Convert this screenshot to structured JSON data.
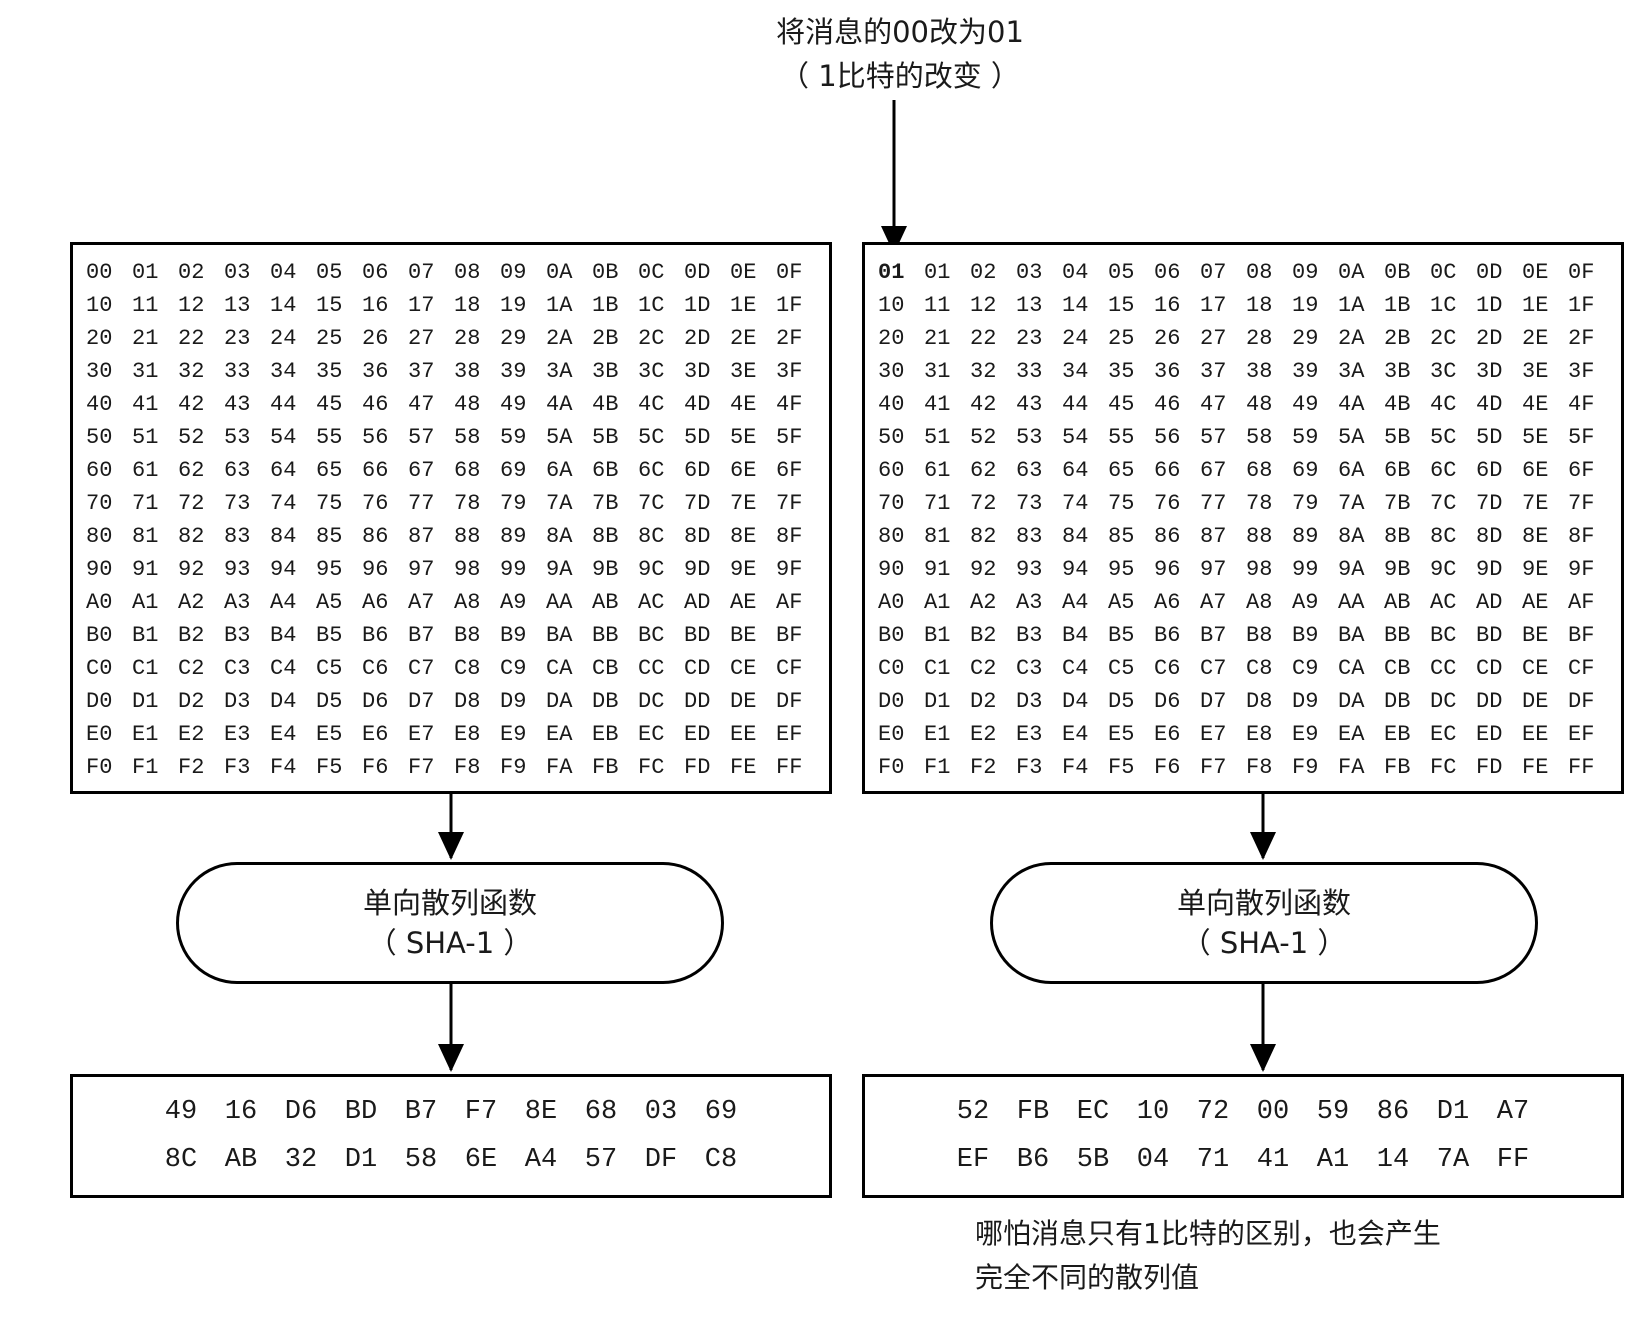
{
  "top_note": {
    "line1": "将消息的00改为01",
    "line2": "（ 1比特的改变 ）"
  },
  "left": {
    "message": [
      [
        "00",
        "01",
        "02",
        "03",
        "04",
        "05",
        "06",
        "07",
        "08",
        "09",
        "0A",
        "0B",
        "0C",
        "0D",
        "0E",
        "0F"
      ],
      [
        "10",
        "11",
        "12",
        "13",
        "14",
        "15",
        "16",
        "17",
        "18",
        "19",
        "1A",
        "1B",
        "1C",
        "1D",
        "1E",
        "1F"
      ],
      [
        "20",
        "21",
        "22",
        "23",
        "24",
        "25",
        "26",
        "27",
        "28",
        "29",
        "2A",
        "2B",
        "2C",
        "2D",
        "2E",
        "2F"
      ],
      [
        "30",
        "31",
        "32",
        "33",
        "34",
        "35",
        "36",
        "37",
        "38",
        "39",
        "3A",
        "3B",
        "3C",
        "3D",
        "3E",
        "3F"
      ],
      [
        "40",
        "41",
        "42",
        "43",
        "44",
        "45",
        "46",
        "47",
        "48",
        "49",
        "4A",
        "4B",
        "4C",
        "4D",
        "4E",
        "4F"
      ],
      [
        "50",
        "51",
        "52",
        "53",
        "54",
        "55",
        "56",
        "57",
        "58",
        "59",
        "5A",
        "5B",
        "5C",
        "5D",
        "5E",
        "5F"
      ],
      [
        "60",
        "61",
        "62",
        "63",
        "64",
        "65",
        "66",
        "67",
        "68",
        "69",
        "6A",
        "6B",
        "6C",
        "6D",
        "6E",
        "6F"
      ],
      [
        "70",
        "71",
        "72",
        "73",
        "74",
        "75",
        "76",
        "77",
        "78",
        "79",
        "7A",
        "7B",
        "7C",
        "7D",
        "7E",
        "7F"
      ],
      [
        "80",
        "81",
        "82",
        "83",
        "84",
        "85",
        "86",
        "87",
        "88",
        "89",
        "8A",
        "8B",
        "8C",
        "8D",
        "8E",
        "8F"
      ],
      [
        "90",
        "91",
        "92",
        "93",
        "94",
        "95",
        "96",
        "97",
        "98",
        "99",
        "9A",
        "9B",
        "9C",
        "9D",
        "9E",
        "9F"
      ],
      [
        "A0",
        "A1",
        "A2",
        "A3",
        "A4",
        "A5",
        "A6",
        "A7",
        "A8",
        "A9",
        "AA",
        "AB",
        "AC",
        "AD",
        "AE",
        "AF"
      ],
      [
        "B0",
        "B1",
        "B2",
        "B3",
        "B4",
        "B5",
        "B6",
        "B7",
        "B8",
        "B9",
        "BA",
        "BB",
        "BC",
        "BD",
        "BE",
        "BF"
      ],
      [
        "C0",
        "C1",
        "C2",
        "C3",
        "C4",
        "C5",
        "C6",
        "C7",
        "C8",
        "C9",
        "CA",
        "CB",
        "CC",
        "CD",
        "CE",
        "CF"
      ],
      [
        "D0",
        "D1",
        "D2",
        "D3",
        "D4",
        "D5",
        "D6",
        "D7",
        "D8",
        "D9",
        "DA",
        "DB",
        "DC",
        "DD",
        "DE",
        "DF"
      ],
      [
        "E0",
        "E1",
        "E2",
        "E3",
        "E4",
        "E5",
        "E6",
        "E7",
        "E8",
        "E9",
        "EA",
        "EB",
        "EC",
        "ED",
        "EE",
        "EF"
      ],
      [
        "F0",
        "F1",
        "F2",
        "F3",
        "F4",
        "F5",
        "F6",
        "F7",
        "F8",
        "F9",
        "FA",
        "FB",
        "FC",
        "FD",
        "FE",
        "FF"
      ]
    ],
    "function": {
      "line1": "单向散列函数",
      "line2": "（ SHA-1 ）"
    },
    "digest": [
      [
        "49",
        "16",
        "D6",
        "BD",
        "B7",
        "F7",
        "8E",
        "68",
        "03",
        "69"
      ],
      [
        "8C",
        "AB",
        "32",
        "D1",
        "58",
        "6E",
        "A4",
        "57",
        "DF",
        "C8"
      ]
    ]
  },
  "right": {
    "message": [
      [
        "01",
        "01",
        "02",
        "03",
        "04",
        "05",
        "06",
        "07",
        "08",
        "09",
        "0A",
        "0B",
        "0C",
        "0D",
        "0E",
        "0F"
      ],
      [
        "10",
        "11",
        "12",
        "13",
        "14",
        "15",
        "16",
        "17",
        "18",
        "19",
        "1A",
        "1B",
        "1C",
        "1D",
        "1E",
        "1F"
      ],
      [
        "20",
        "21",
        "22",
        "23",
        "24",
        "25",
        "26",
        "27",
        "28",
        "29",
        "2A",
        "2B",
        "2C",
        "2D",
        "2E",
        "2F"
      ],
      [
        "30",
        "31",
        "32",
        "33",
        "34",
        "35",
        "36",
        "37",
        "38",
        "39",
        "3A",
        "3B",
        "3C",
        "3D",
        "3E",
        "3F"
      ],
      [
        "40",
        "41",
        "42",
        "43",
        "44",
        "45",
        "46",
        "47",
        "48",
        "49",
        "4A",
        "4B",
        "4C",
        "4D",
        "4E",
        "4F"
      ],
      [
        "50",
        "51",
        "52",
        "53",
        "54",
        "55",
        "56",
        "57",
        "58",
        "59",
        "5A",
        "5B",
        "5C",
        "5D",
        "5E",
        "5F"
      ],
      [
        "60",
        "61",
        "62",
        "63",
        "64",
        "65",
        "66",
        "67",
        "68",
        "69",
        "6A",
        "6B",
        "6C",
        "6D",
        "6E",
        "6F"
      ],
      [
        "70",
        "71",
        "72",
        "73",
        "74",
        "75",
        "76",
        "77",
        "78",
        "79",
        "7A",
        "7B",
        "7C",
        "7D",
        "7E",
        "7F"
      ],
      [
        "80",
        "81",
        "82",
        "83",
        "84",
        "85",
        "86",
        "87",
        "88",
        "89",
        "8A",
        "8B",
        "8C",
        "8D",
        "8E",
        "8F"
      ],
      [
        "90",
        "91",
        "92",
        "93",
        "94",
        "95",
        "96",
        "97",
        "98",
        "99",
        "9A",
        "9B",
        "9C",
        "9D",
        "9E",
        "9F"
      ],
      [
        "A0",
        "A1",
        "A2",
        "A3",
        "A4",
        "A5",
        "A6",
        "A7",
        "A8",
        "A9",
        "AA",
        "AB",
        "AC",
        "AD",
        "AE",
        "AF"
      ],
      [
        "B0",
        "B1",
        "B2",
        "B3",
        "B4",
        "B5",
        "B6",
        "B7",
        "B8",
        "B9",
        "BA",
        "BB",
        "BC",
        "BD",
        "BE",
        "BF"
      ],
      [
        "C0",
        "C1",
        "C2",
        "C3",
        "C4",
        "C5",
        "C6",
        "C7",
        "C8",
        "C9",
        "CA",
        "CB",
        "CC",
        "CD",
        "CE",
        "CF"
      ],
      [
        "D0",
        "D1",
        "D2",
        "D3",
        "D4",
        "D5",
        "D6",
        "D7",
        "D8",
        "D9",
        "DA",
        "DB",
        "DC",
        "DD",
        "DE",
        "DF"
      ],
      [
        "E0",
        "E1",
        "E2",
        "E3",
        "E4",
        "E5",
        "E6",
        "E7",
        "E8",
        "E9",
        "EA",
        "EB",
        "EC",
        "ED",
        "EE",
        "EF"
      ],
      [
        "F0",
        "F1",
        "F2",
        "F3",
        "F4",
        "F5",
        "F6",
        "F7",
        "F8",
        "F9",
        "FA",
        "FB",
        "FC",
        "FD",
        "FE",
        "FF"
      ]
    ],
    "function": {
      "line1": "单向散列函数",
      "line2": "（ SHA-1 ）"
    },
    "digest": [
      [
        "52",
        "FB",
        "EC",
        "10",
        "72",
        "00",
        "59",
        "86",
        "D1",
        "A7"
      ],
      [
        "EF",
        "B6",
        "5B",
        "04",
        "71",
        "41",
        "A1",
        "14",
        "7A",
        "FF"
      ]
    ]
  },
  "bottom_note": {
    "line1": "哪怕消息只有1比特的区别，也会产生",
    "line2": "完全不同的散列值"
  }
}
